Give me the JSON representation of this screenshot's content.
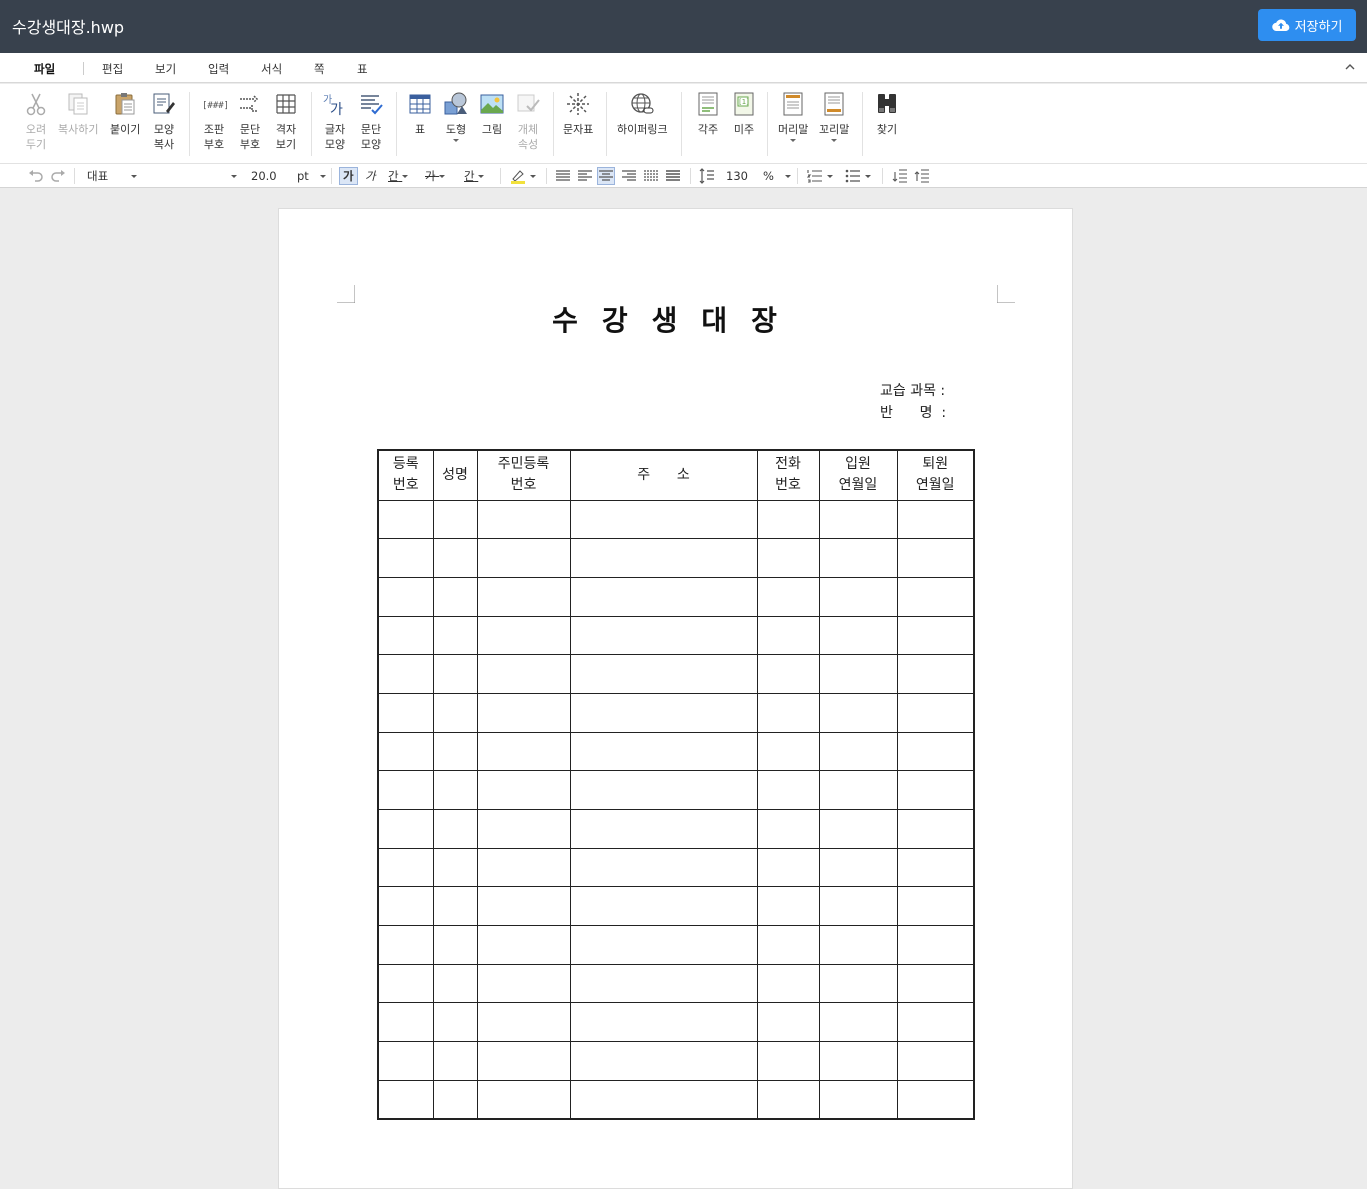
{
  "titlebar": {
    "doc_title": "수강생대장.hwp",
    "save_label": "저장하기"
  },
  "menu": {
    "tabs": [
      "파일",
      "편집",
      "보기",
      "입력",
      "서식",
      "쪽",
      "표"
    ]
  },
  "ribbon": {
    "cut": "오려\n두기",
    "copy": "복사하기",
    "paste": "붙이기",
    "format_copy": "모양\n복사",
    "markup": "조판\n부호",
    "para_mark": "문단\n부호",
    "grid_view": "격자\n보기",
    "char_shape": "글자\n모양",
    "para_shape": "문단\n모양",
    "table": "표",
    "shape": "도형",
    "picture": "그림",
    "obj_props": "개체\n속성",
    "symbols": "문자표",
    "hyperlink": "하이퍼링크",
    "footnote": "각주",
    "endnote": "미주",
    "header": "머리말",
    "footer": "꼬리말",
    "find": "찾기"
  },
  "format": {
    "style": "대표",
    "font_size": "20.0",
    "unit": "pt",
    "bold": "가",
    "italic": "가",
    "underline": "간",
    "strike": "가",
    "font_color": "간",
    "line_spacing": "130",
    "spacing_unit": "%"
  },
  "document": {
    "heading": "수강생대장",
    "info_subject": "교습 과목 :",
    "info_class": "반      명  :",
    "columns": [
      "등록\n번호",
      "성명",
      "주민등록\n번호",
      "주      소",
      "전화\n번호",
      "입원\n연월일",
      "퇴원\n연월일"
    ],
    "blank_rows": 16
  }
}
